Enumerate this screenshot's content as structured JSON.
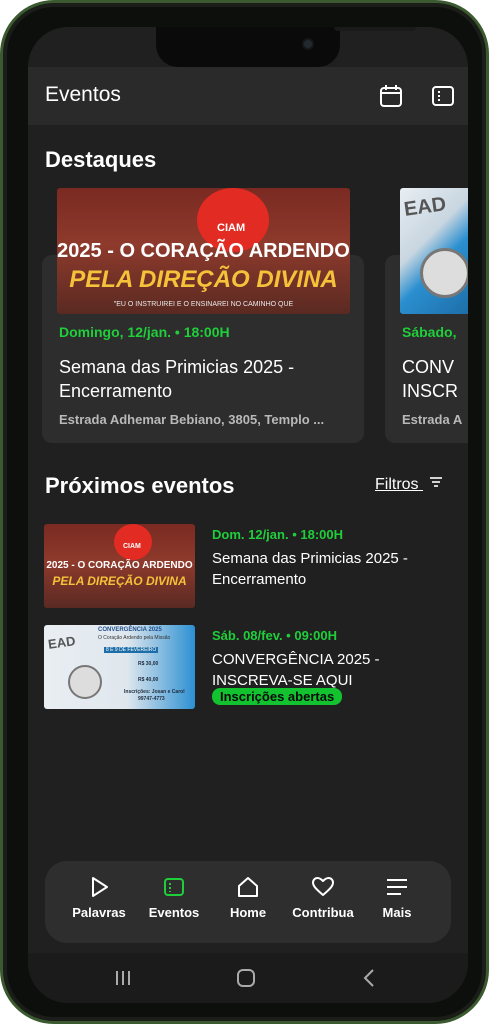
{
  "appbar": {
    "title": "Eventos",
    "calendar_icon": "calendar-icon",
    "list_icon": "sidebar-toggle-icon"
  },
  "highlights": {
    "title": "Destaques",
    "cards": [
      {
        "banner_title_line1": "2025 - O CORAÇÃO ARDENDO",
        "banner_title_line2": "PELA DIREÇÃO DIVINA",
        "banner_logo_text": "CIAM",
        "banner_verse": "\"EU O INSTRUIREI E O ENSINAREI NO CAMINHO QUE",
        "date": "Domingo, 12/jan. • 18:00H",
        "name": "Semana das Primicias 2025 - Encerramento",
        "location": "Estrada Adhemar Bebiano, 3805, Templo ..."
      },
      {
        "banner_text": "EAD",
        "date": "Sábado,",
        "name_line1": "CONV",
        "name_line2": "INSCR",
        "location": "Estrada A"
      }
    ]
  },
  "upcoming": {
    "title": "Próximos eventos",
    "filters_label": "Filtros",
    "items": [
      {
        "date": "Dom. 12/jan. • 18:00H",
        "name": "Semana das Primicias 2025 - Encerramento",
        "thumb_line1": "2025 - O CORAÇÃO ARDENDO",
        "thumb_line2": "PELA DIREÇÃO DIVINA",
        "thumb_logo": "CIAM"
      },
      {
        "date": "Sáb. 08/fev. • 09:00H",
        "name": "CONVERGÊNCIA 2025 - INSCREVA-SE AQUI",
        "badge": "Inscrições abertas",
        "thumb_title": "CONVERGÊNCIA 2025",
        "thumb_sub": "O Coração Ardendo pela Missão",
        "thumb_date": "8 E 9 DE FEVEREIRO",
        "thumb_price1": "R$ 30,00",
        "thumb_price2": "R$ 40,00",
        "thumb_contact": "Inscrições: Josan e Carol",
        "thumb_phone": "99747-4773",
        "thumb_ead": "EAD"
      }
    ]
  },
  "nav": {
    "items": [
      {
        "label": "Palavras",
        "icon": "play-icon"
      },
      {
        "label": "Eventos",
        "icon": "events-icon",
        "active": true
      },
      {
        "label": "Home",
        "icon": "home-icon"
      },
      {
        "label": "Contribua",
        "icon": "heart-icon"
      },
      {
        "label": "Mais",
        "icon": "menu-icon"
      }
    ]
  },
  "colors": {
    "accent": "#1fcf3a",
    "background": "#202020",
    "card": "#2d2d2d"
  }
}
